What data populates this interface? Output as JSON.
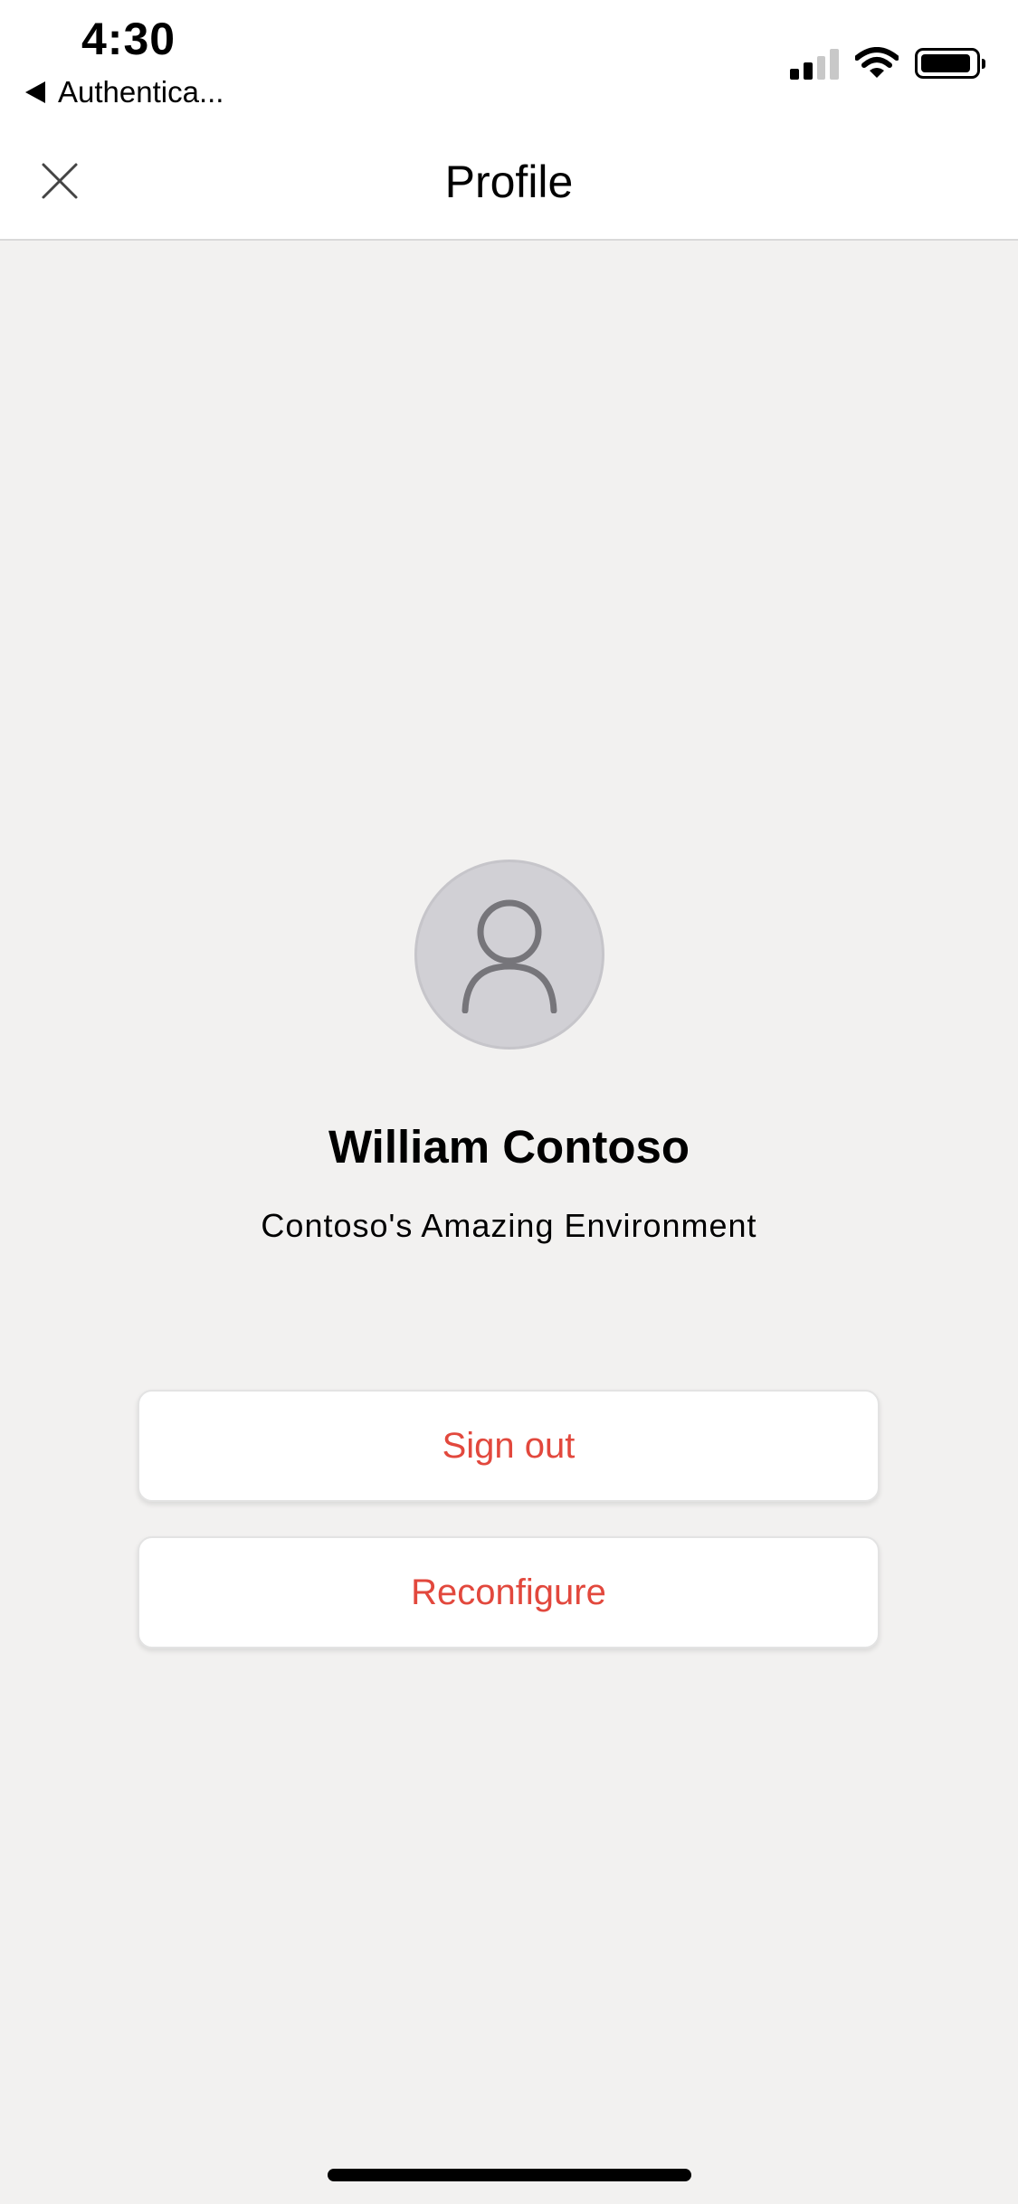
{
  "status_bar": {
    "time": "4:30",
    "back_app_label": "Authentica...",
    "icons": [
      "cellular-signal-icon",
      "wifi-icon",
      "battery-icon"
    ],
    "signal_bars_active": 2,
    "signal_bars_total": 4
  },
  "nav": {
    "title": "Profile",
    "close_icon": "close-icon"
  },
  "profile": {
    "avatar_icon": "person-icon",
    "name": "William Contoso",
    "environment": "Contoso's Amazing Environment"
  },
  "actions": {
    "sign_out_label": "Sign out",
    "reconfigure_label": "Reconfigure"
  },
  "colors": {
    "accent": "#e2483d",
    "background": "#f2f1f0",
    "surface": "#ffffff",
    "avatar_fill": "#d1d0d5",
    "avatar_glyph": "#76757a"
  }
}
